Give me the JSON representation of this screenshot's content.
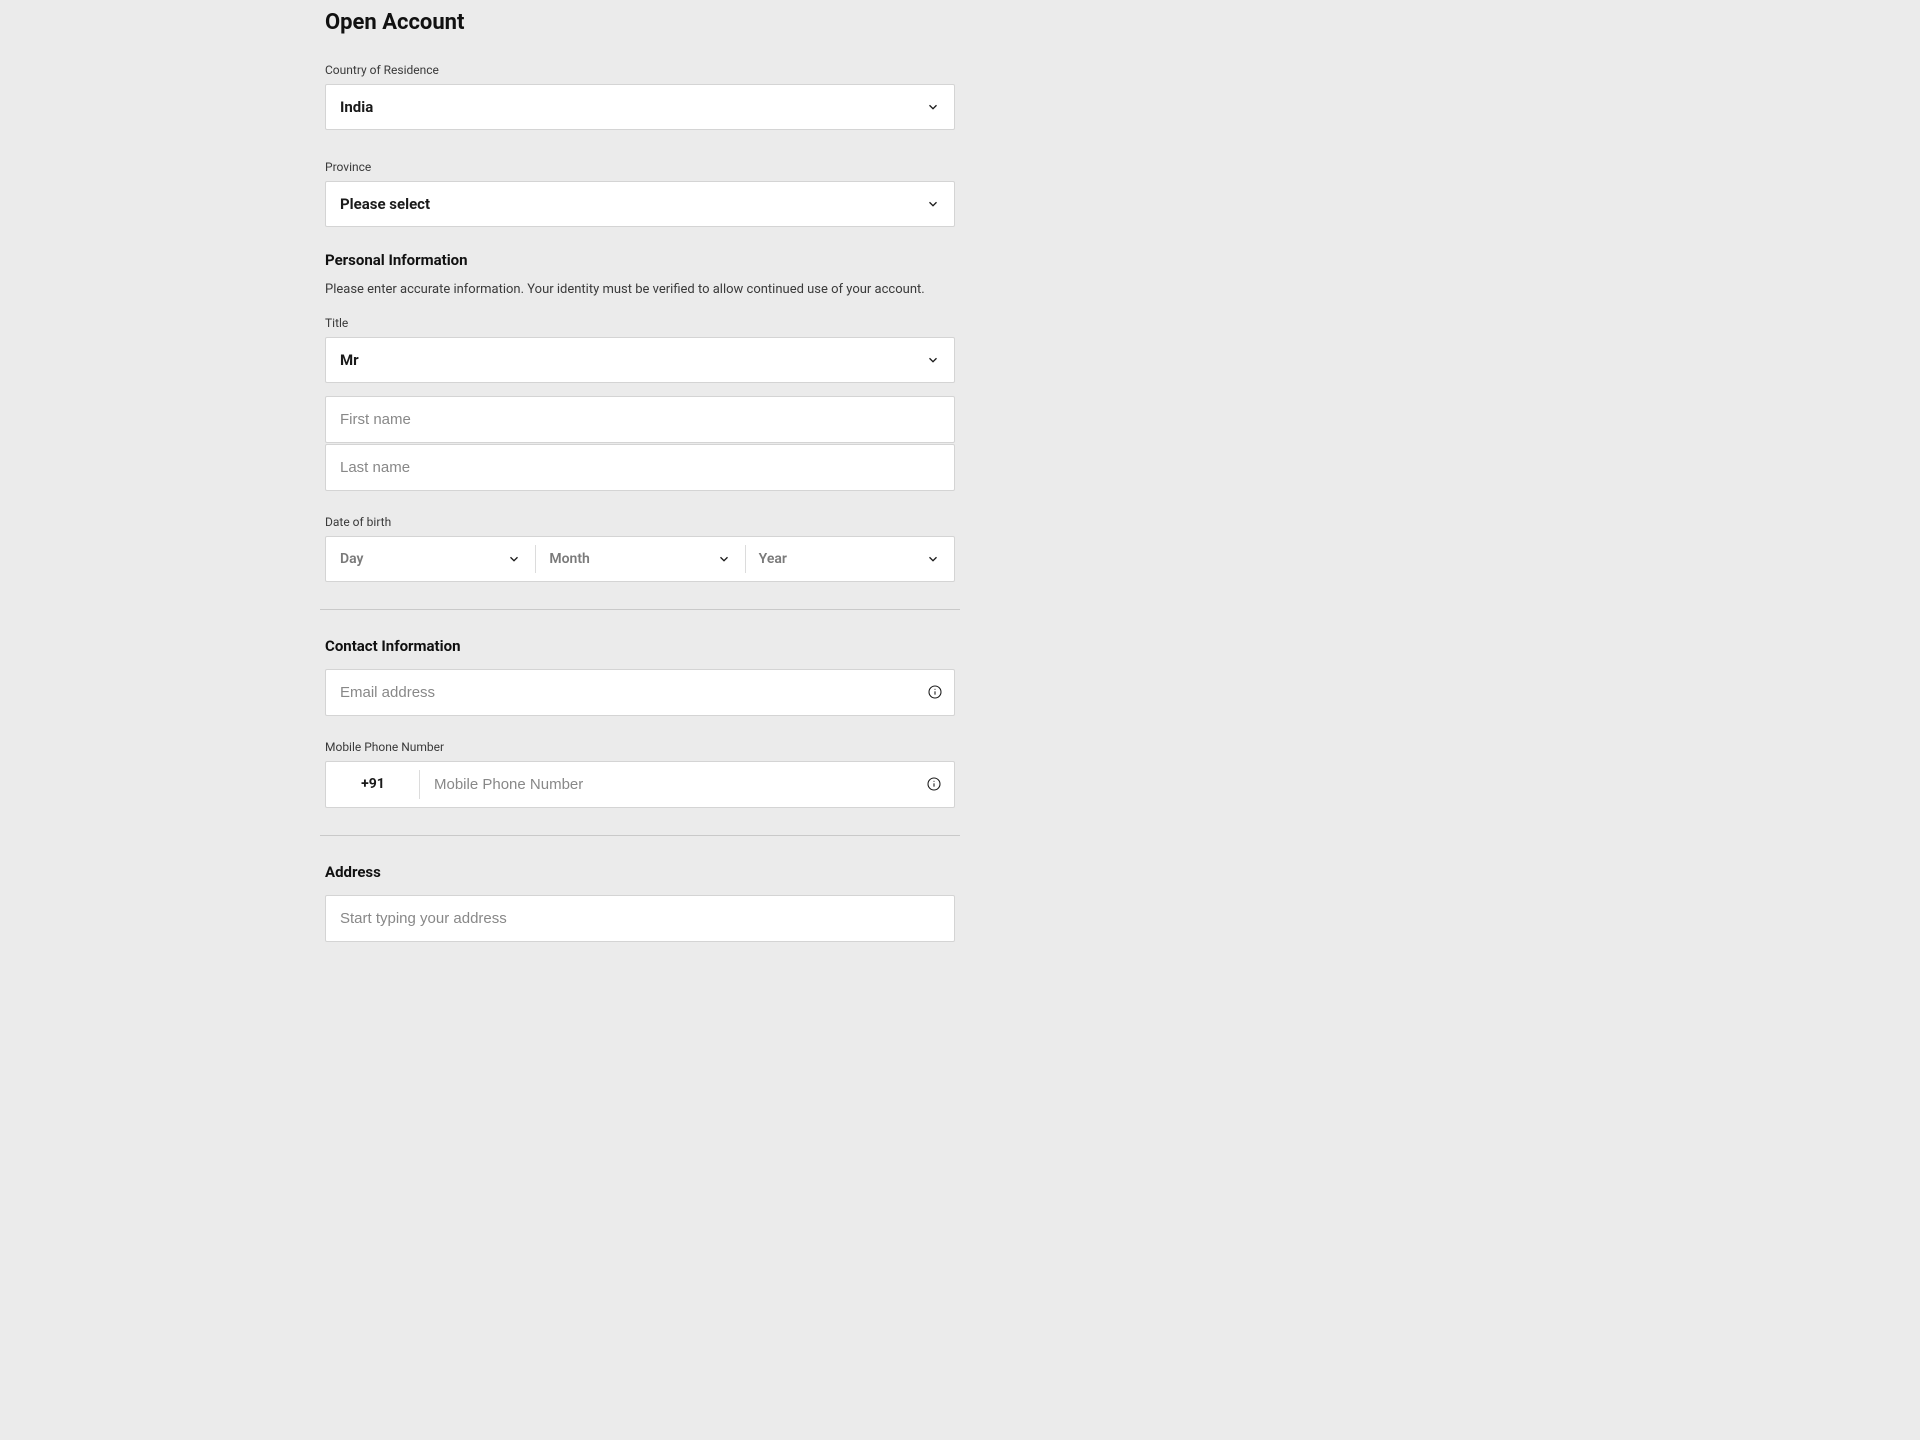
{
  "page": {
    "title": "Open Account"
  },
  "country": {
    "label": "Country of Residence",
    "value": "India"
  },
  "province": {
    "label": "Province",
    "value": "Please select"
  },
  "personal": {
    "heading": "Personal Information",
    "description": "Please enter accurate information. Your identity must be verified to allow continued use of your account.",
    "title_label": "Title",
    "title_value": "Mr",
    "first_name_placeholder": "First name",
    "last_name_placeholder": "Last name",
    "dob_label": "Date of birth",
    "dob_day": "Day",
    "dob_month": "Month",
    "dob_year": "Year"
  },
  "contact": {
    "heading": "Contact Information",
    "email_placeholder": "Email address",
    "phone_label": "Mobile Phone Number",
    "phone_prefix": "+91",
    "phone_placeholder": "Mobile Phone Number"
  },
  "address": {
    "heading": "Address",
    "search_placeholder": "Start typing your address"
  }
}
